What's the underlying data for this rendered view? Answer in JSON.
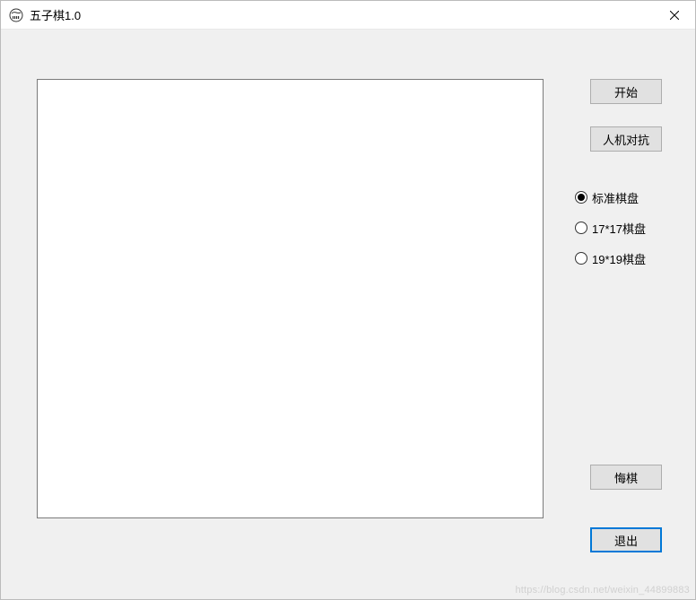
{
  "window": {
    "title": "五子棋1.0"
  },
  "buttons": {
    "start": "开始",
    "ai": "人机对抗",
    "undo": "悔棋",
    "exit": "退出"
  },
  "board_size_options": [
    {
      "label": "标准棋盘",
      "selected": true
    },
    {
      "label": "17*17棋盘",
      "selected": false
    },
    {
      "label": "19*19棋盘",
      "selected": false
    }
  ],
  "watermark": "https://blog.csdn.net/weixin_44899883"
}
